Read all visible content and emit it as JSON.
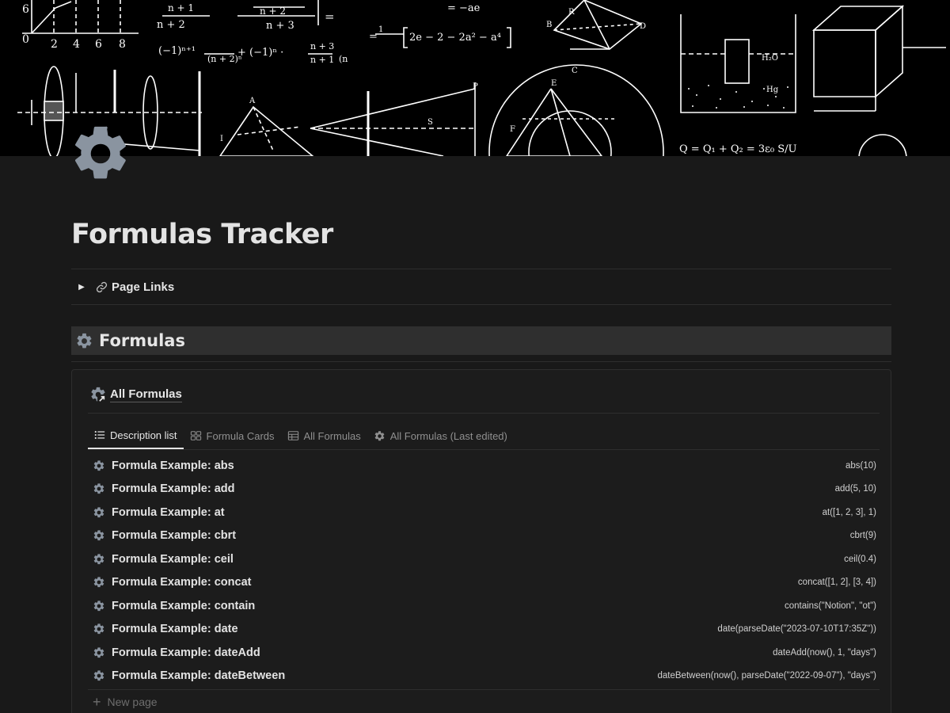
{
  "page": {
    "title": "Formulas Tracker",
    "icon": "gear-icon"
  },
  "toggle": {
    "label": "Page Links",
    "arrow": "▶",
    "icon": "link-icon"
  },
  "heading": {
    "text": "Formulas",
    "icon": "gear-icon"
  },
  "database": {
    "title": "All Formulas",
    "title_icon": "gear-link-icon",
    "tabs": [
      {
        "label": "Description list",
        "icon": "list-icon",
        "active": true
      },
      {
        "label": "Formula Cards",
        "icon": "gallery-icon",
        "active": false
      },
      {
        "label": "All Formulas",
        "icon": "table-icon",
        "active": false
      },
      {
        "label": "All Formulas (Last edited)",
        "icon": "gear-icon",
        "active": false
      }
    ],
    "rows": [
      {
        "title": "Formula Example: abs",
        "code": "abs(10)"
      },
      {
        "title": "Formula Example: add",
        "code": "add(5, 10)"
      },
      {
        "title": "Formula Example: at",
        "code": "at([1, 2, 3], 1)"
      },
      {
        "title": "Formula Example: cbrt",
        "code": "cbrt(9)"
      },
      {
        "title": "Formula Example: ceil",
        "code": "ceil(0.4)"
      },
      {
        "title": "Formula Example: concat",
        "code": "concat([1, 2], [3, 4])"
      },
      {
        "title": "Formula Example: contain",
        "code": "contains(\"Notion\", \"ot\")"
      },
      {
        "title": "Formula Example: date",
        "code": "date(parseDate(\"2023-07-10T17:35Z\"))"
      },
      {
        "title": "Formula Example: dateAdd",
        "code": "dateAdd(now(), 1, \"days\")"
      },
      {
        "title": "Formula Example: dateBetween",
        "code": "dateBetween(now(), parseDate(\"2022-09-07\"), \"days\")"
      }
    ],
    "new_page_label": "New page"
  },
  "cover": {
    "formulas": [
      "n + 1",
      "n + 2",
      "n + 3",
      "(−1)ⁿ⁺¹",
      "(n + 2)ⁿ",
      "+ (−1)ⁿ ·",
      "n + 3",
      "n + 1",
      "(n",
      "= −ae",
      "= 1/(a²e) [2e − 2 − 2a² − a⁴].",
      "Q = Q₁ + Q₂ = 3ε₀ S/U",
      "H₂O",
      "Hg",
      "A",
      "B",
      "C",
      "D",
      "E",
      "F",
      "P",
      "R",
      "S",
      "I"
    ]
  },
  "colors": {
    "background": "#191919",
    "heading_bg": "#2f2f2f",
    "icon_gray": "#8a94a0",
    "text": "#e6e6e6",
    "muted": "#8f8f8f"
  }
}
